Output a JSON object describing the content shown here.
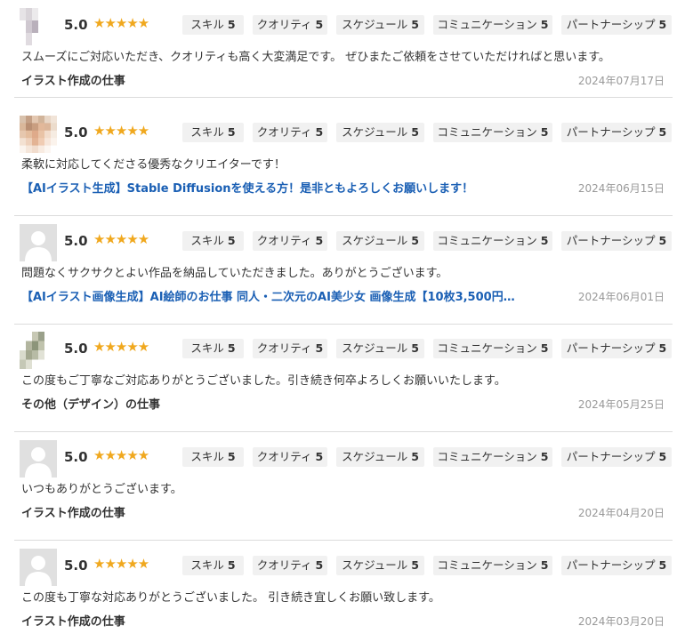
{
  "reviews": [
    {
      "rating": "5.0",
      "stars": "★★★★★",
      "avatar": "mosaic",
      "scores": [
        {
          "label": "スキル",
          "value": "5"
        },
        {
          "label": "クオリティ",
          "value": "5"
        },
        {
          "label": "スケジュール",
          "value": "5"
        },
        {
          "label": "コミュニケーション",
          "value": "5"
        },
        {
          "label": "パートナーシップ",
          "value": "5"
        }
      ],
      "comment": "スムーズにご対応いただき、クオリティも高く大変満足です。 ぜひまたご依頼をさせていただければと思います。",
      "job_title": "イラスト作成の仕事",
      "job_is_link": false,
      "date": "2024年07月17日"
    },
    {
      "rating": "5.0",
      "stars": "★★★★★",
      "avatar": "mosaic-face",
      "scores": [
        {
          "label": "スキル",
          "value": "5"
        },
        {
          "label": "クオリティ",
          "value": "5"
        },
        {
          "label": "スケジュール",
          "value": "5"
        },
        {
          "label": "コミュニケーション",
          "value": "5"
        },
        {
          "label": "パートナーシップ",
          "value": "5"
        }
      ],
      "comment": "柔軟に対応してくださる優秀なクリエイターです！",
      "job_title": "【AIイラスト生成】Stable Diffusionを使える方！是非ともよろしくお願いします！",
      "job_is_link": true,
      "date": "2024年06月15日"
    },
    {
      "rating": "5.0",
      "stars": "★★★★★",
      "avatar": "default",
      "scores": [
        {
          "label": "スキル",
          "value": "5"
        },
        {
          "label": "クオリティ",
          "value": "5"
        },
        {
          "label": "スケジュール",
          "value": "5"
        },
        {
          "label": "コミュニケーション",
          "value": "5"
        },
        {
          "label": "パートナーシップ",
          "value": "5"
        }
      ],
      "comment": "問題なくサクサクとよい作品を納品していただきました。ありがとうございます。",
      "job_title": "【AIイラスト画像生成】AI絵師のお仕事 同人・二次元のAI美少女 画像生成【10枚3,500円…",
      "job_is_link": true,
      "date": "2024年06月01日"
    },
    {
      "rating": "5.0",
      "stars": "★★★★★",
      "avatar": "mosaic-green",
      "scores": [
        {
          "label": "スキル",
          "value": "5"
        },
        {
          "label": "クオリティ",
          "value": "5"
        },
        {
          "label": "スケジュール",
          "value": "5"
        },
        {
          "label": "コミュニケーション",
          "value": "5"
        },
        {
          "label": "パートナーシップ",
          "value": "5"
        }
      ],
      "comment": "この度もご丁寧なご対応ありがとうございました。引き続き何卒よろしくお願いいたします。",
      "job_title": "その他（デザイン）の仕事",
      "job_is_link": false,
      "date": "2024年05月25日"
    },
    {
      "rating": "5.0",
      "stars": "★★★★★",
      "avatar": "default",
      "scores": [
        {
          "label": "スキル",
          "value": "5"
        },
        {
          "label": "クオリティ",
          "value": "5"
        },
        {
          "label": "スケジュール",
          "value": "5"
        },
        {
          "label": "コミュニケーション",
          "value": "5"
        },
        {
          "label": "パートナーシップ",
          "value": "5"
        }
      ],
      "comment": "いつもありがとうございます。",
      "job_title": "イラスト作成の仕事",
      "job_is_link": false,
      "date": "2024年04月20日"
    },
    {
      "rating": "5.0",
      "stars": "★★★★★",
      "avatar": "default",
      "scores": [
        {
          "label": "スキル",
          "value": "5"
        },
        {
          "label": "クオリティ",
          "value": "5"
        },
        {
          "label": "スケジュール",
          "value": "5"
        },
        {
          "label": "コミュニケーション",
          "value": "5"
        },
        {
          "label": "パートナーシップ",
          "value": "5"
        }
      ],
      "comment": "この度も丁寧な対応ありがとうございました。 引き続き宜しくお願い致します。",
      "job_title": "イラスト作成の仕事",
      "job_is_link": false,
      "date": "2024年03月20日"
    }
  ],
  "colors": {
    "star": "#f0a81e",
    "link": "#1a5fb4",
    "badge_bg": "#f1f1f1",
    "divider": "#dcdcdc",
    "date": "#999999"
  }
}
